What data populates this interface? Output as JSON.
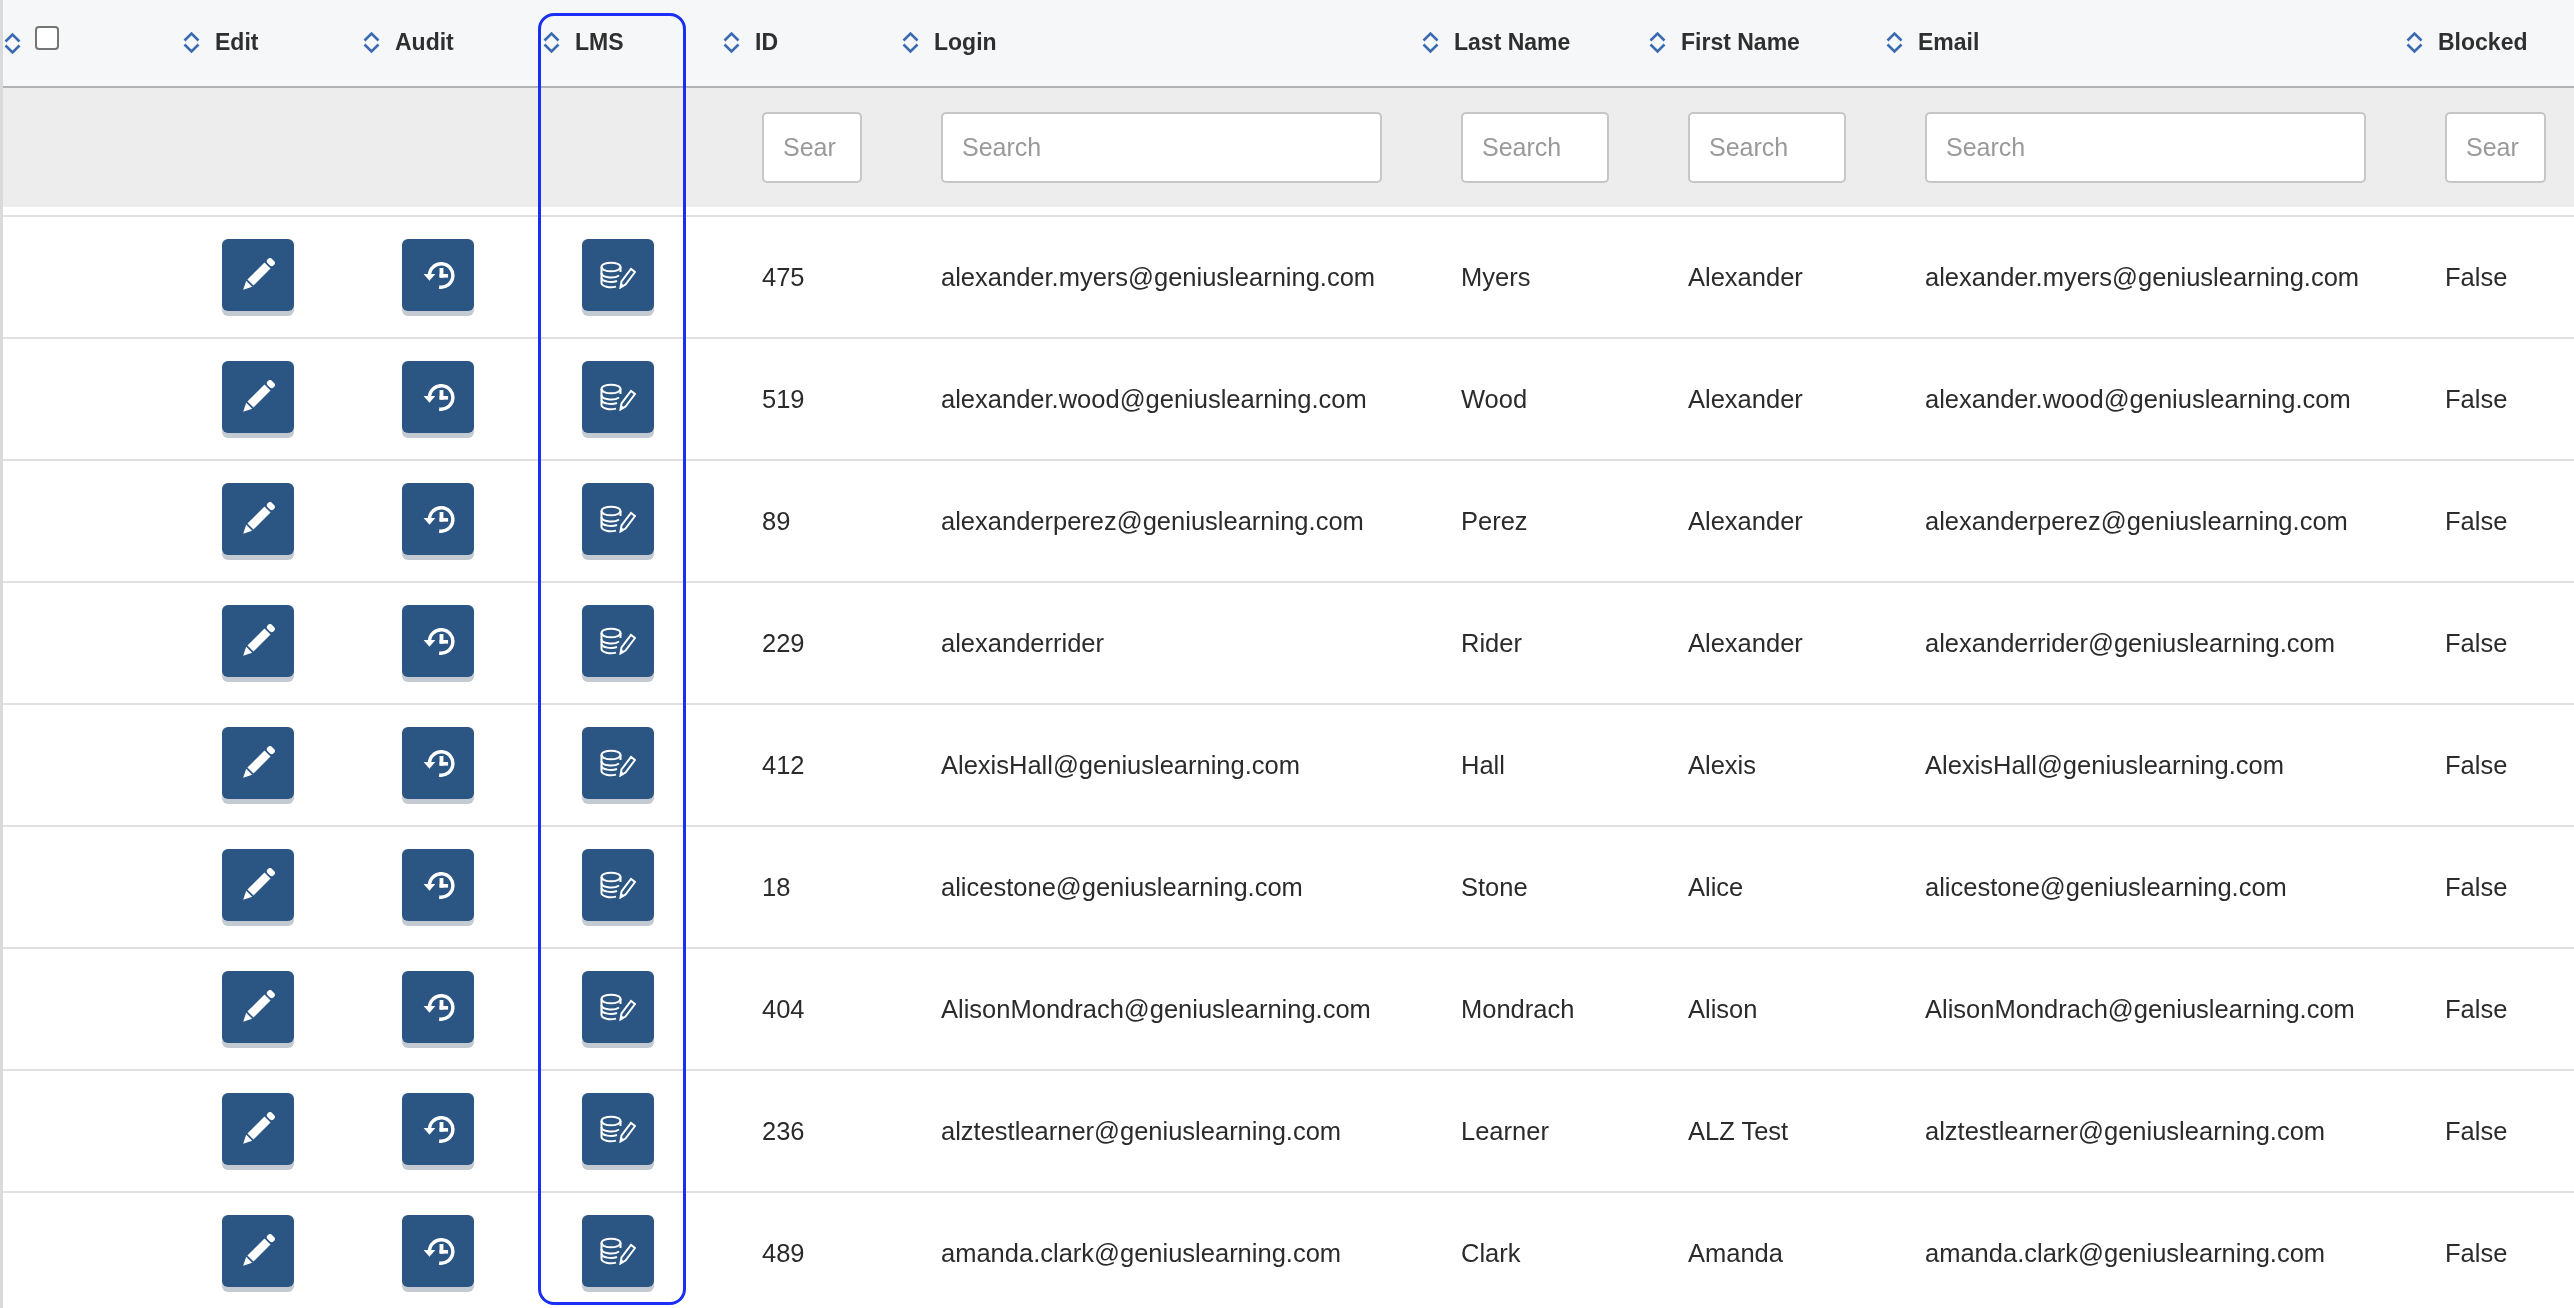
{
  "table": {
    "select_all": {
      "checked": false
    },
    "action_columns": [
      {
        "label": "Edit",
        "kind": "edit",
        "highlighted": false
      },
      {
        "label": "Audit",
        "kind": "audit",
        "highlighted": false
      },
      {
        "label": "LMS",
        "kind": "lms",
        "highlighted": true
      }
    ],
    "columns": [
      {
        "label": "ID",
        "highlighted": false,
        "search": {
          "placeholder": "Sear"
        }
      },
      {
        "label": "Login",
        "highlighted": false,
        "search": {
          "placeholder": "Search"
        }
      },
      {
        "label": "Last Name",
        "highlighted": false,
        "search": {
          "placeholder": "Search"
        }
      },
      {
        "label": "First Name",
        "highlighted": false,
        "search": {
          "placeholder": "Search"
        }
      },
      {
        "label": "Email",
        "highlighted": false,
        "search": {
          "placeholder": "Search"
        }
      },
      {
        "label": "Blocked",
        "highlighted": false,
        "search": {
          "placeholder": "Sear"
        }
      }
    ],
    "rows": [
      [
        "475",
        "alexander.myers@geniuslearning.com",
        "Myers",
        "Alexander",
        "alexander.myers@geniuslearning.com",
        "False"
      ],
      [
        "519",
        "alexander.wood@geniuslearning.com",
        "Wood",
        "Alexander",
        "alexander.wood@geniuslearning.com",
        "False"
      ],
      [
        "89",
        "alexanderperez@geniuslearning.com",
        "Perez",
        "Alexander",
        "alexanderperez@geniuslearning.com",
        "False"
      ],
      [
        "229",
        "alexanderrider",
        "Rider",
        "Alexander",
        "alexanderrider@geniuslearning.com",
        "False"
      ],
      [
        "412",
        "AlexisHall@geniuslearning.com",
        "Hall",
        "Alexis",
        "AlexisHall@geniuslearning.com",
        "False"
      ],
      [
        "18",
        "alicestone@geniuslearning.com",
        "Stone",
        "Alice",
        "alicestone@geniuslearning.com",
        "False"
      ],
      [
        "404",
        "AlisonMondrach@geniuslearning.com",
        "Mondrach",
        "Alison",
        "AlisonMondrach@geniuslearning.com",
        "False"
      ],
      [
        "236",
        "alztestlearner@geniuslearning.com",
        "Learner",
        "ALZ Test",
        "alztestlearner@geniuslearning.com",
        "False"
      ],
      [
        "489",
        "amanda.clark@geniuslearning.com",
        "Clark",
        "Amanda",
        "amanda.clark@geniuslearning.com",
        "False"
      ]
    ]
  }
}
